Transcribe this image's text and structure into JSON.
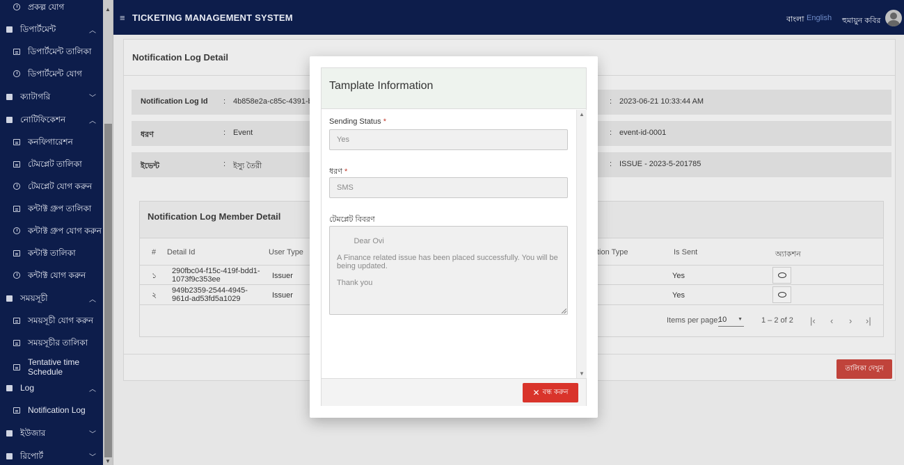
{
  "sidebar": {
    "items": [
      {
        "label": "প্রকল্প যোগ",
        "kind": "child",
        "icon": "history-icon"
      },
      {
        "label": "ডিপার্টমেন্ট",
        "kind": "parent",
        "chevron": "up"
      },
      {
        "label": "ডিপার্টমেন্ট তালিকা",
        "kind": "child",
        "icon": "list-icon"
      },
      {
        "label": "ডিপার্টমেন্ট যোগ",
        "kind": "child",
        "icon": "history-icon"
      },
      {
        "label": "ক্যাটাগরি",
        "kind": "parent",
        "chevron": "down"
      },
      {
        "label": "নোটিফিকেশন",
        "kind": "parent",
        "chevron": "up"
      },
      {
        "label": "কনফিগারেশন",
        "kind": "child",
        "icon": "list-icon"
      },
      {
        "label": "টেমপ্লেট তালিকা",
        "kind": "child",
        "icon": "list-icon"
      },
      {
        "label": "টেমপ্লেট যোগ করুন",
        "kind": "child",
        "icon": "history-icon"
      },
      {
        "label": "কন্টাক্ট গ্রুপ তালিকা",
        "kind": "child",
        "icon": "list-icon"
      },
      {
        "label": "কন্টাক্ট গ্রুপ যোগ করুন",
        "kind": "child",
        "icon": "history-icon"
      },
      {
        "label": "কন্টাক্ট তালিকা",
        "kind": "child",
        "icon": "list-icon"
      },
      {
        "label": "কন্টাক্ট যোগ করুন",
        "kind": "child",
        "icon": "history-icon"
      },
      {
        "label": "সময়সূচী",
        "kind": "parent",
        "chevron": "up"
      },
      {
        "label": "সময়সূচী যোগ করুন",
        "kind": "child",
        "icon": "list-icon"
      },
      {
        "label": "সময়সূচীর তালিকা",
        "kind": "child",
        "icon": "list-icon"
      },
      {
        "label": "Tentative time Schedule",
        "kind": "child",
        "icon": "list-icon"
      },
      {
        "label": "Log",
        "kind": "parent",
        "chevron": "up"
      },
      {
        "label": "Notification Log",
        "kind": "child",
        "icon": "list-icon"
      },
      {
        "label": "ইউজার",
        "kind": "parent",
        "chevron": "down"
      },
      {
        "label": "রিপোর্ট",
        "kind": "parent",
        "chevron": "down"
      }
    ]
  },
  "header": {
    "title": "TICKETING MANAGEMENT SYSTEM",
    "lang_bn": "বাংলা",
    "lang_en": "English",
    "user_name": "হুমায়ুন কবির"
  },
  "page": {
    "title": "Notification Log Detail",
    "info_rows": [
      {
        "key": "Notification Log Id",
        "value": "4b858e2a-c85c-4391-b",
        "value2": "2023-06-21 10:33:44 AM"
      },
      {
        "key": "ধরণ",
        "value": "Event",
        "value2": "event-id-0001"
      },
      {
        "key": "ইভেন্ট",
        "value": "ইস্যু তৈরী",
        "value2": "ISSUE - 2023-5-201785"
      }
    ],
    "colon": ":",
    "members": {
      "title": "Notification Log Member Detail",
      "columns": [
        "#",
        "Detail Id",
        "User Type",
        "tion Type",
        "Is Sent",
        "অ্যাকশন"
      ],
      "rows": [
        {
          "num": "১",
          "detail_id": "290fbc04-f15c-419f-bdd1-1073f9c353ee",
          "user_type": "Issuer",
          "is_sent": "Yes"
        },
        {
          "num": "২",
          "detail_id": "949b2359-2544-4945-961d-ad53fd5a1029",
          "user_type": "Issuer",
          "is_sent": "Yes"
        }
      ],
      "items_per_page_label": "Items per page:",
      "items_per_page": "10",
      "range": "1 – 2 of 2"
    },
    "list_button": "তালিকা দেখুন"
  },
  "modal": {
    "title": "Tamplate Information",
    "sending_status_label": "Sending Status",
    "sending_status_value": "Yes",
    "type_label": "ধরণ",
    "type_value": "SMS",
    "required_mark": "*",
    "description_label": "টেমপ্লেট বিবরণ",
    "description_value": "Dear Ovi\n\nA Finance related issue has been placed successfully. You will be being updated.\n\nThank you",
    "close_button": "বন্ধ করুন"
  },
  "colors": {
    "sidebar_bg": "#0d1d4b",
    "accent_red": "#d9342b",
    "link_blue": "#6f8cc8"
  }
}
